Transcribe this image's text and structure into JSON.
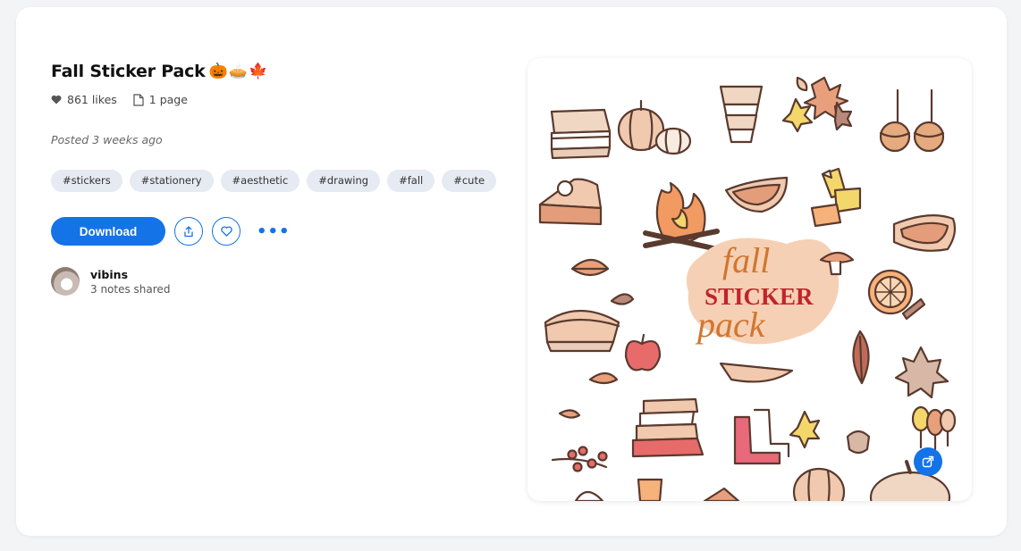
{
  "post": {
    "title": "Fall Sticker Pack",
    "title_emoji": "🎃🥧🍁",
    "likes": "861 likes",
    "pages": "1 page",
    "posted": "Posted 3 weeks ago"
  },
  "tags": [
    "#stickers",
    "#stationery",
    "#aesthetic",
    "#drawing",
    "#fall",
    "#cute"
  ],
  "actions": {
    "download_label": "Download",
    "share_icon": "share-icon",
    "like_icon": "heart-outline-icon",
    "more_label": "•••"
  },
  "author": {
    "name": "vibins",
    "sub": "3 notes shared"
  },
  "preview": {
    "artwork": {
      "line1": "fall",
      "line2": "STICKER",
      "line3": "pack"
    },
    "expand_icon": "expand-icon"
  },
  "colors": {
    "accent": "#1473e6",
    "tag_bg": "#e6eaf2",
    "outline": "#5a3a2e"
  }
}
